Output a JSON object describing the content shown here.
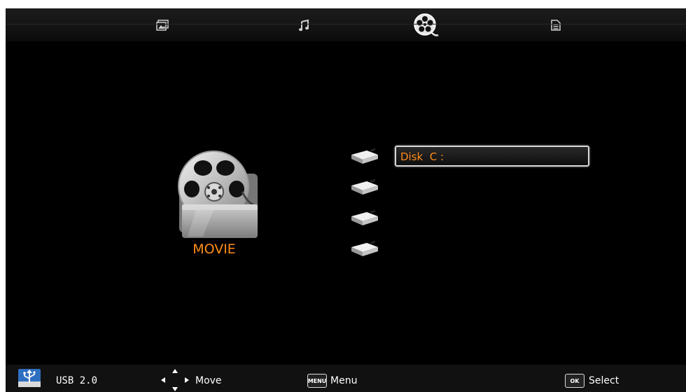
{
  "tabs": [
    {
      "name": "photo",
      "icon": "photo-icon"
    },
    {
      "name": "music",
      "icon": "music-note-icon"
    },
    {
      "name": "movie",
      "icon": "film-reel-icon",
      "selected": true
    },
    {
      "name": "text",
      "icon": "document-icon"
    }
  ],
  "main": {
    "category_label": "MOVIE",
    "disks": [
      {
        "label": "Disk  C :",
        "selected": true
      },
      {
        "label": ""
      },
      {
        "label": ""
      },
      {
        "label": ""
      }
    ]
  },
  "bottom": {
    "usb_label": "USB 2.0",
    "move_label": "Move",
    "menu_key": "MENU",
    "menu_label": "Menu",
    "ok_key": "OK",
    "select_label": "Select"
  },
  "colors": {
    "accent": "#ff8c1a",
    "background": "#000000",
    "bar": "#111111"
  }
}
